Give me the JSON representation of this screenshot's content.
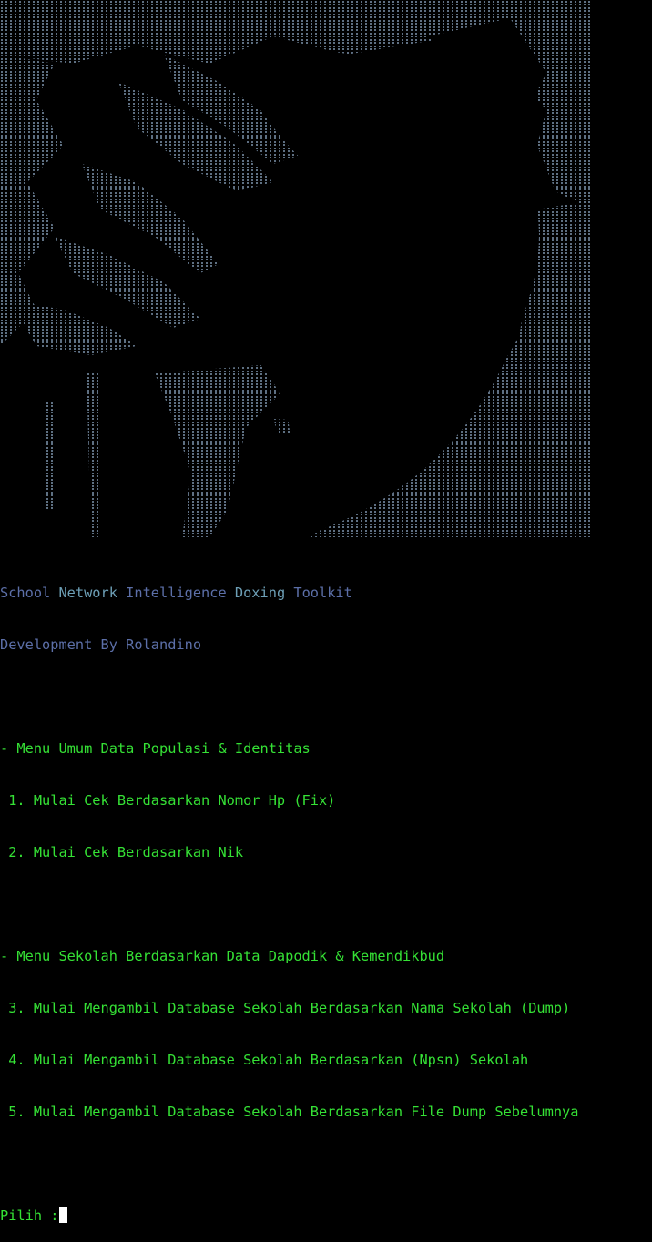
{
  "colors": {
    "background": "#000000",
    "banner_blue": "#5c6fa8",
    "banner_teal": "#6d9fb6",
    "menu_green": "#35e135",
    "cursor": "#ffffff",
    "art_top": "#64758a",
    "art_bottom": "#5cc09a"
  },
  "banner": {
    "words": [
      {
        "text": "School",
        "tone": "blue"
      },
      {
        "text": "Network",
        "tone": "teal"
      },
      {
        "text": "Intelligence",
        "tone": "blue"
      },
      {
        "text": "Doxing",
        "tone": "teal"
      },
      {
        "text": "Toolkit",
        "tone": "blue"
      }
    ],
    "credit": "Development By Rolandino"
  },
  "menu": {
    "section_general": "- Menu Umum Data Populasi & Identitas",
    "opt1": " 1. Mulai Cek Berdasarkan Nomor Hp (Fix)",
    "opt2": " 2. Mulai Cek Berdasarkan Nik",
    "section_school": "- Menu Sekolah Berdasarkan Data Dapodik & Kemendikbud",
    "opt3": " 3. Mulai Mengambil Database Sekolah Berdasarkan Nama Sekolah (Dump)",
    "opt4": " 4. Mulai Mengambil Database Sekolah Berdasarkan (Npsn) Sekolah",
    "opt5": " 5. Mulai Mengambil Database Sekolah Berdasarkan File Dump Sebelumnya"
  },
  "prompt": {
    "label": "Pilih :"
  }
}
